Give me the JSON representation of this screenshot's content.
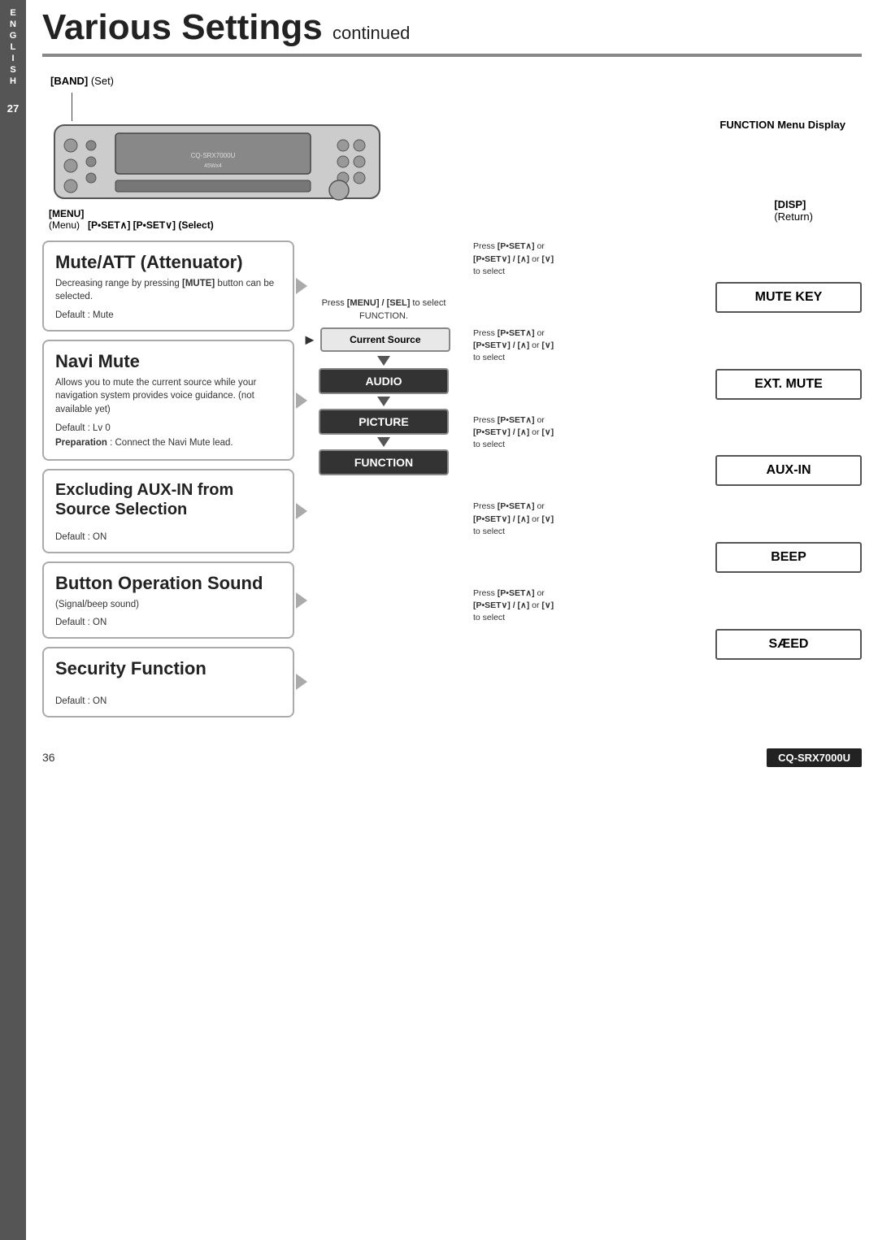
{
  "page": {
    "title": "Various Settings",
    "title_suffix": " continued",
    "left_bar": {
      "letters": [
        "E",
        "N",
        "G",
        "L",
        "I",
        "S",
        "H"
      ],
      "page_number": "27"
    }
  },
  "device": {
    "band_label": "[BAND]",
    "band_set": "(Set)",
    "menu_label": "[MENU]",
    "menu_sub": "(Menu)",
    "pset_select": "[P•SET∧] [P•SET∨] (Select)",
    "function_label": "FUNCTION Menu Display",
    "disp_label": "[DISP]",
    "disp_sub": "(Return)",
    "brand": "CQ-SRX7000U",
    "model": "45Wx4"
  },
  "sections": [
    {
      "id": "mute-att",
      "title": "Mute/ATT (Attenuator)",
      "body": "Decreasing range by pressing [MUTE] button can be selected.",
      "body_bold": "[MUTE]",
      "default": "Default : Mute"
    },
    {
      "id": "navi-mute",
      "title": "Navi Mute",
      "body": "Allows you to mute the current source while your navigation system provides voice guidance. (not available yet)",
      "default_lv": "Default : Lv  0",
      "prep_label": "Preparation",
      "prep_text": ": Connect the Navi Mute lead."
    },
    {
      "id": "excluding-aux",
      "title": "Excluding AUX-IN from Source Selection",
      "default": "Default : ON"
    },
    {
      "id": "button-op",
      "title": "Button Operation Sound",
      "sub": "(Signal/beep sound)",
      "default": "Default : ON"
    },
    {
      "id": "security",
      "title": "Security Function",
      "default": "Default : ON"
    }
  ],
  "middle": {
    "press_menu_label": "Press",
    "press_menu_bold": "[MENU] / [SEL]",
    "press_menu_suffix": "to select FUNCTION.",
    "current_source": "Current Source",
    "audio": "AUDIO",
    "picture": "PICTURE",
    "function": "FUNCTION"
  },
  "right_options": [
    {
      "id": "mute-key",
      "press_text1": "Press [P•SET∧] or",
      "press_text2": "[P•SET∨] / [∧] or [∨]",
      "press_text3": "to select",
      "result": "MUTE KEY"
    },
    {
      "id": "ext-mute",
      "press_text1": "Press [P•SET∧] or",
      "press_text2": "[P•SET∨] / [∧] or [∨]",
      "press_text3": "to select",
      "result": "EXT. MUTE"
    },
    {
      "id": "aux-in",
      "press_text1": "Press [P•SET∧] or",
      "press_text2": "[P•SET∨] / [∧] or [∨]",
      "press_text3": "to select",
      "result": "AUX-IN"
    },
    {
      "id": "beep",
      "press_text1": "Press [P•SET∧] or",
      "press_text2": "[P•SET∨] / [∧] or [∨]",
      "press_text3": "to select",
      "result": "BEEP"
    },
    {
      "id": "saeed",
      "press_text1": "Press [P•SET∧] or",
      "press_text2": "[P•SET∨] / [∧] or [∨]",
      "press_text3": "to select",
      "result": "SÆED"
    }
  ],
  "footer": {
    "page_number": "36",
    "model": "CQ-SRX7000U"
  }
}
